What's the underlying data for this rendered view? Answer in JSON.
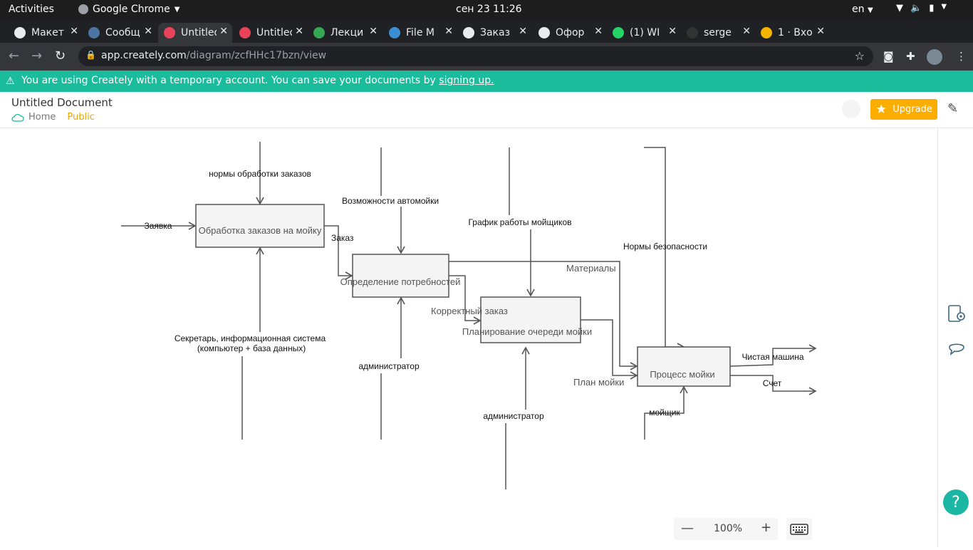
{
  "os": {
    "activities": "Activities",
    "app_name": "Google Chrome",
    "clock": "сен 23  11:26",
    "lang": "en"
  },
  "tabs": [
    {
      "label": "Макет",
      "icon_color": "#e8eaed"
    },
    {
      "label": "Сообщ",
      "icon_color": "#4c75a3"
    },
    {
      "label": "Untitled",
      "icon_color": "#e9435a",
      "active": true
    },
    {
      "label": "Untitled",
      "icon_color": "#e9435a"
    },
    {
      "label": "Лекци",
      "icon_color": "#34a853"
    },
    {
      "label": "File M",
      "icon_color": "#3b8ed4"
    },
    {
      "label": "Заказ",
      "icon_color": "#e8eaed"
    },
    {
      "label": "Офор",
      "icon_color": "#e8eaed"
    },
    {
      "label": "(1) WI",
      "icon_color": "#25d366"
    },
    {
      "label": "serge",
      "icon_color": "#333333"
    },
    {
      "label": "1 · Вхо",
      "icon_color": "#f4b400"
    }
  ],
  "browser": {
    "url_domain": "app.creately.com",
    "url_path": "/diagram/zcfHHc17bzn/view"
  },
  "banner": {
    "text": "You are using Creately with a temporary account. You can save your documents by",
    "link": "signing up."
  },
  "doc": {
    "title": "Untitled Document",
    "home": "Home",
    "visibility": "Public",
    "upgrade": "Upgrade"
  },
  "zoom": {
    "value": "100%"
  },
  "colors": {
    "accent": "#1bbc9b",
    "upgrade": "#fbad00",
    "box_fill": "#f4f4f4",
    "line": "#555555"
  },
  "diagram": {
    "boxes": {
      "b1": "Обработка заказов на мойку",
      "b2": "Определение потребностей",
      "b3": "Планирование очереди мойки",
      "b4": "Процесс мойки"
    },
    "labels": {
      "norms": "нормы обработки заказов",
      "request": "Заявка",
      "order": "Заказ",
      "capabilities": "Возможности автомойки",
      "schedule": "График работы мойщиков",
      "safety": "Нормы безопасности",
      "materials": "Материалы",
      "correct_order": "Корректный заказ",
      "wash_plan": "План мойки",
      "clean_car": "Чистая машина",
      "invoice": "Счет",
      "secretary_1": "Секретарь, информационная система",
      "secretary_2": "(компьютер + база данных)",
      "admin1": "администратор",
      "admin2": "администратор",
      "washer": "мойщик"
    }
  }
}
